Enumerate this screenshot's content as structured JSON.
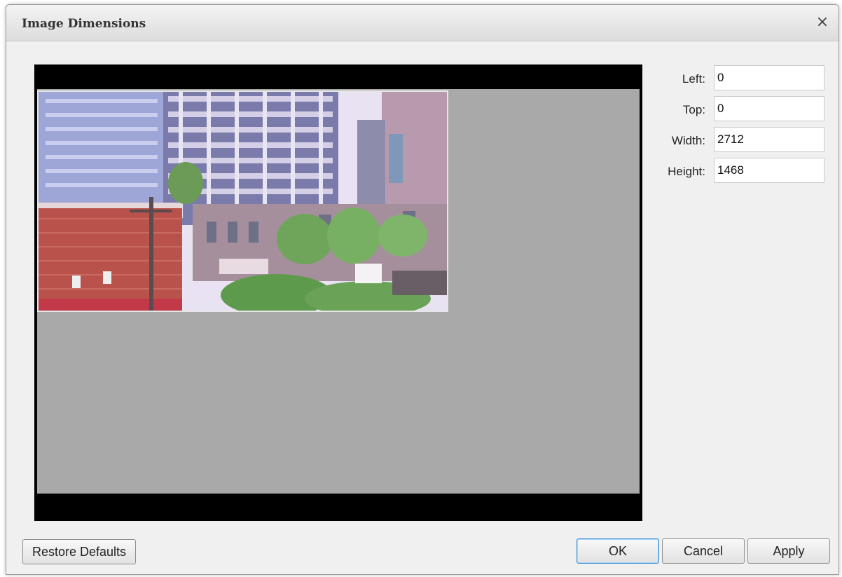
{
  "dialog": {
    "title": "Image Dimensions",
    "close_glyph": "×"
  },
  "preview": {
    "image_description_icon": "camera-snapshot"
  },
  "fields": {
    "left": {
      "label": "Left:",
      "value": "0"
    },
    "top": {
      "label": "Top:",
      "value": "0"
    },
    "width": {
      "label": "Width:",
      "value": "2712"
    },
    "height": {
      "label": "Height:",
      "value": "1468"
    }
  },
  "buttons": {
    "restore_defaults": "Restore Defaults",
    "ok": "OK",
    "cancel": "Cancel",
    "apply": "Apply"
  },
  "colors": {
    "preview_background": "#a9a9a9",
    "letterbox": "#000000",
    "default_button_border": "#3c8fd6"
  }
}
